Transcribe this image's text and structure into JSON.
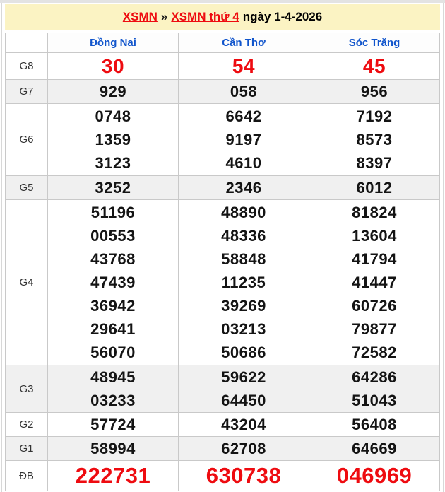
{
  "colors": {
    "red": "#ee0b10",
    "blue": "#1155cc",
    "banner": "#fbf3c3",
    "shaded": "#f0f0f0",
    "border": "#c9c9c9"
  },
  "title": {
    "link1": "XSMN",
    "separator": "»",
    "link2": "XSMN thứ 4",
    "suffix": "ngày 1-4-2026"
  },
  "table": {
    "columns": [
      "Đồng Nai",
      "Cần Thơ",
      "Sóc Trăng"
    ],
    "rows": [
      {
        "id": "g8",
        "label": "G8",
        "emphasis": "medium",
        "values": [
          [
            "30"
          ],
          [
            "54"
          ],
          [
            "45"
          ]
        ]
      },
      {
        "id": "g7",
        "label": "G7",
        "emphasis": "none",
        "values": [
          [
            "929"
          ],
          [
            "058"
          ],
          [
            "956"
          ]
        ]
      },
      {
        "id": "g6",
        "label": "G6",
        "emphasis": "none",
        "values": [
          [
            "0748",
            "1359",
            "3123"
          ],
          [
            "6642",
            "9197",
            "4610"
          ],
          [
            "7192",
            "8573",
            "8397"
          ]
        ]
      },
      {
        "id": "g5",
        "label": "G5",
        "emphasis": "none",
        "values": [
          [
            "3252"
          ],
          [
            "2346"
          ],
          [
            "6012"
          ]
        ]
      },
      {
        "id": "g4",
        "label": "G4",
        "emphasis": "none",
        "values": [
          [
            "51196",
            "00553",
            "43768",
            "47439",
            "36942",
            "29641",
            "56070"
          ],
          [
            "48890",
            "48336",
            "58848",
            "11235",
            "39269",
            "03213",
            "50686"
          ],
          [
            "81824",
            "13604",
            "41794",
            "41447",
            "60726",
            "79877",
            "72582"
          ]
        ]
      },
      {
        "id": "g3",
        "label": "G3",
        "emphasis": "none",
        "values": [
          [
            "48945",
            "03233"
          ],
          [
            "59622",
            "64450"
          ],
          [
            "64286",
            "51043"
          ]
        ]
      },
      {
        "id": "g2",
        "label": "G2",
        "emphasis": "none",
        "values": [
          [
            "57724"
          ],
          [
            "43204"
          ],
          [
            "56408"
          ]
        ]
      },
      {
        "id": "g1",
        "label": "G1",
        "emphasis": "none",
        "values": [
          [
            "58994"
          ],
          [
            "62708"
          ],
          [
            "64669"
          ]
        ]
      },
      {
        "id": "db",
        "label": "ĐB",
        "emphasis": "large",
        "values": [
          [
            "222731"
          ],
          [
            "630738"
          ],
          [
            "046969"
          ]
        ]
      }
    ]
  }
}
